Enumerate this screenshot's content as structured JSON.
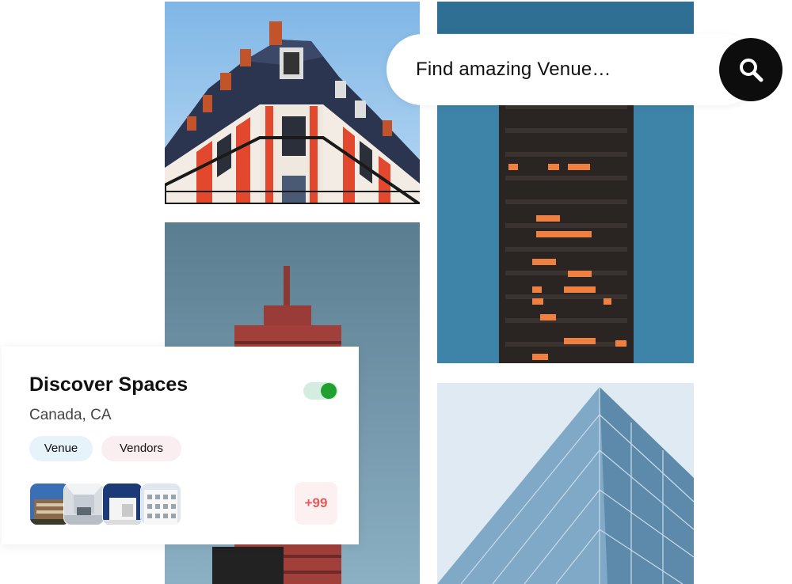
{
  "search": {
    "placeholder": "Find amazing Venue…",
    "icon": "search-icon"
  },
  "card": {
    "title": "Discover Spaces",
    "location": "Canada, CA",
    "toggle_on": true,
    "tags": [
      "Venue",
      "Vendors"
    ],
    "more_count": "+99"
  },
  "colors": {
    "toggle_accent": "#1fa02f",
    "venue_tag_bg": "#e6f3fb",
    "vendors_tag_bg": "#fbeef1",
    "more_badge_text": "#e85a5a",
    "search_button_bg": "#0d0d0d"
  }
}
